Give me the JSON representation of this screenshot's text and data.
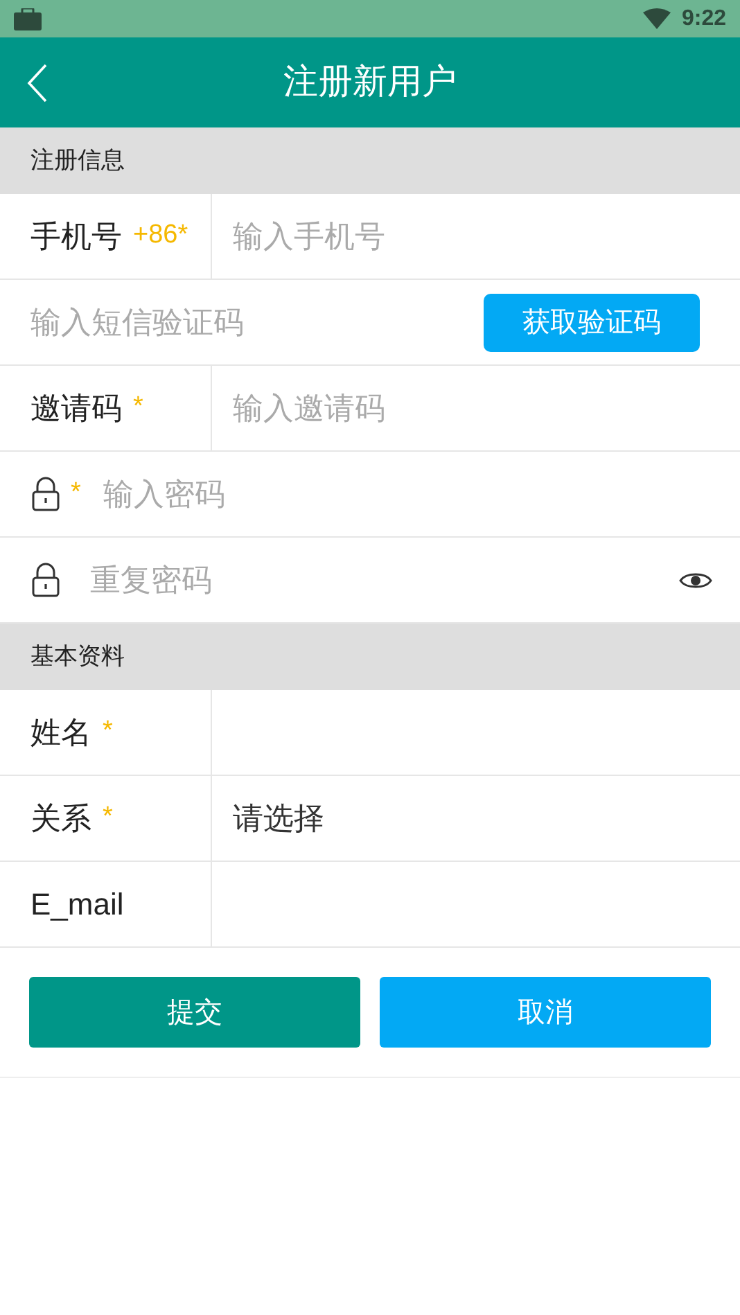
{
  "status_bar": {
    "time": "9:22"
  },
  "header": {
    "title": "注册新用户"
  },
  "sections": [
    {
      "title": "注册信息",
      "rows": [
        {
          "kind": "labeled",
          "label": "手机号",
          "marker": "+86*",
          "placeholder": "输入手机号"
        },
        {
          "kind": "code",
          "placeholder": "输入短信验证码",
          "button": "获取验证码"
        },
        {
          "kind": "labeled",
          "label": "邀请码",
          "marker": "*",
          "placeholder": "输入邀请码"
        },
        {
          "kind": "password",
          "marker": "*",
          "placeholder": "输入密码",
          "reveal": false
        },
        {
          "kind": "password",
          "placeholder": "重复密码",
          "reveal": true
        }
      ]
    },
    {
      "title": "基本资料",
      "rows": [
        {
          "kind": "labeled",
          "label": "姓名",
          "marker": "*"
        },
        {
          "kind": "select",
          "label": "关系",
          "marker": "*",
          "value": "请选择"
        },
        {
          "kind": "labeled",
          "label": "E_mail"
        }
      ]
    }
  ],
  "buttons": [
    {
      "label": "提交",
      "kind": "primary"
    },
    {
      "label": "取消",
      "kind": "secondary"
    }
  ]
}
